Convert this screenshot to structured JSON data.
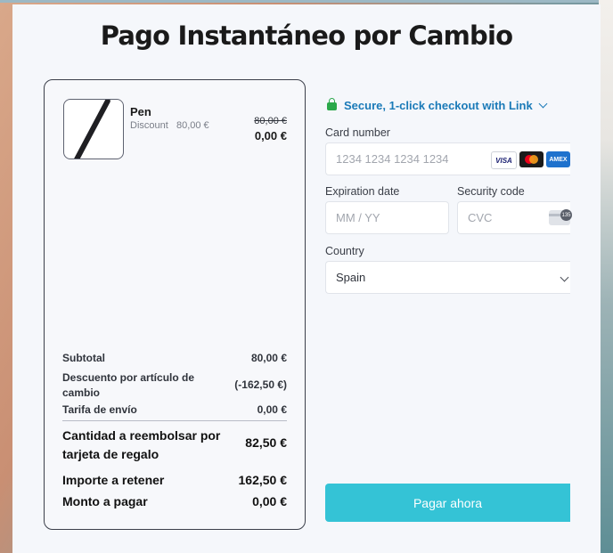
{
  "page": {
    "title": "Pago Instantáneo por Cambio"
  },
  "summary": {
    "item": {
      "name": "Pen",
      "discount_label": "Discount",
      "discount_value": "80,00 €",
      "original_price": "80,00 €",
      "price": "0,00 €"
    },
    "rows": [
      {
        "label": "Subtotal",
        "value": "80,00 €"
      },
      {
        "label": "Descuento por artículo de cambio",
        "value": "(-162,50 €)"
      },
      {
        "label": "Tarifa de envío",
        "value": "0,00 €"
      },
      {
        "label": "Cantidad a reembolsar por tarjeta de regalo",
        "value": "82,50 €"
      },
      {
        "label": "Importe a retener",
        "value": "162,50 €"
      },
      {
        "label": "Monto a pagar",
        "value": "0,00 €"
      }
    ]
  },
  "payment": {
    "link_text": "Secure, 1-click checkout with Link",
    "card_number": {
      "label": "Card number",
      "placeholder": "1234 1234 1234 1234"
    },
    "brands": [
      "VISA",
      "mastercard",
      "AMEX"
    ],
    "expiry": {
      "label": "Expiration date",
      "placeholder": "MM / YY"
    },
    "cvc": {
      "label": "Security code",
      "placeholder": "CVC",
      "badge": "135"
    },
    "country": {
      "label": "Country",
      "value": "Spain"
    },
    "pay_button": "Pagar ahora"
  },
  "colors": {
    "accent": "#34c3d6",
    "link": "#1a7ab8",
    "lock": "#2ba84a"
  }
}
